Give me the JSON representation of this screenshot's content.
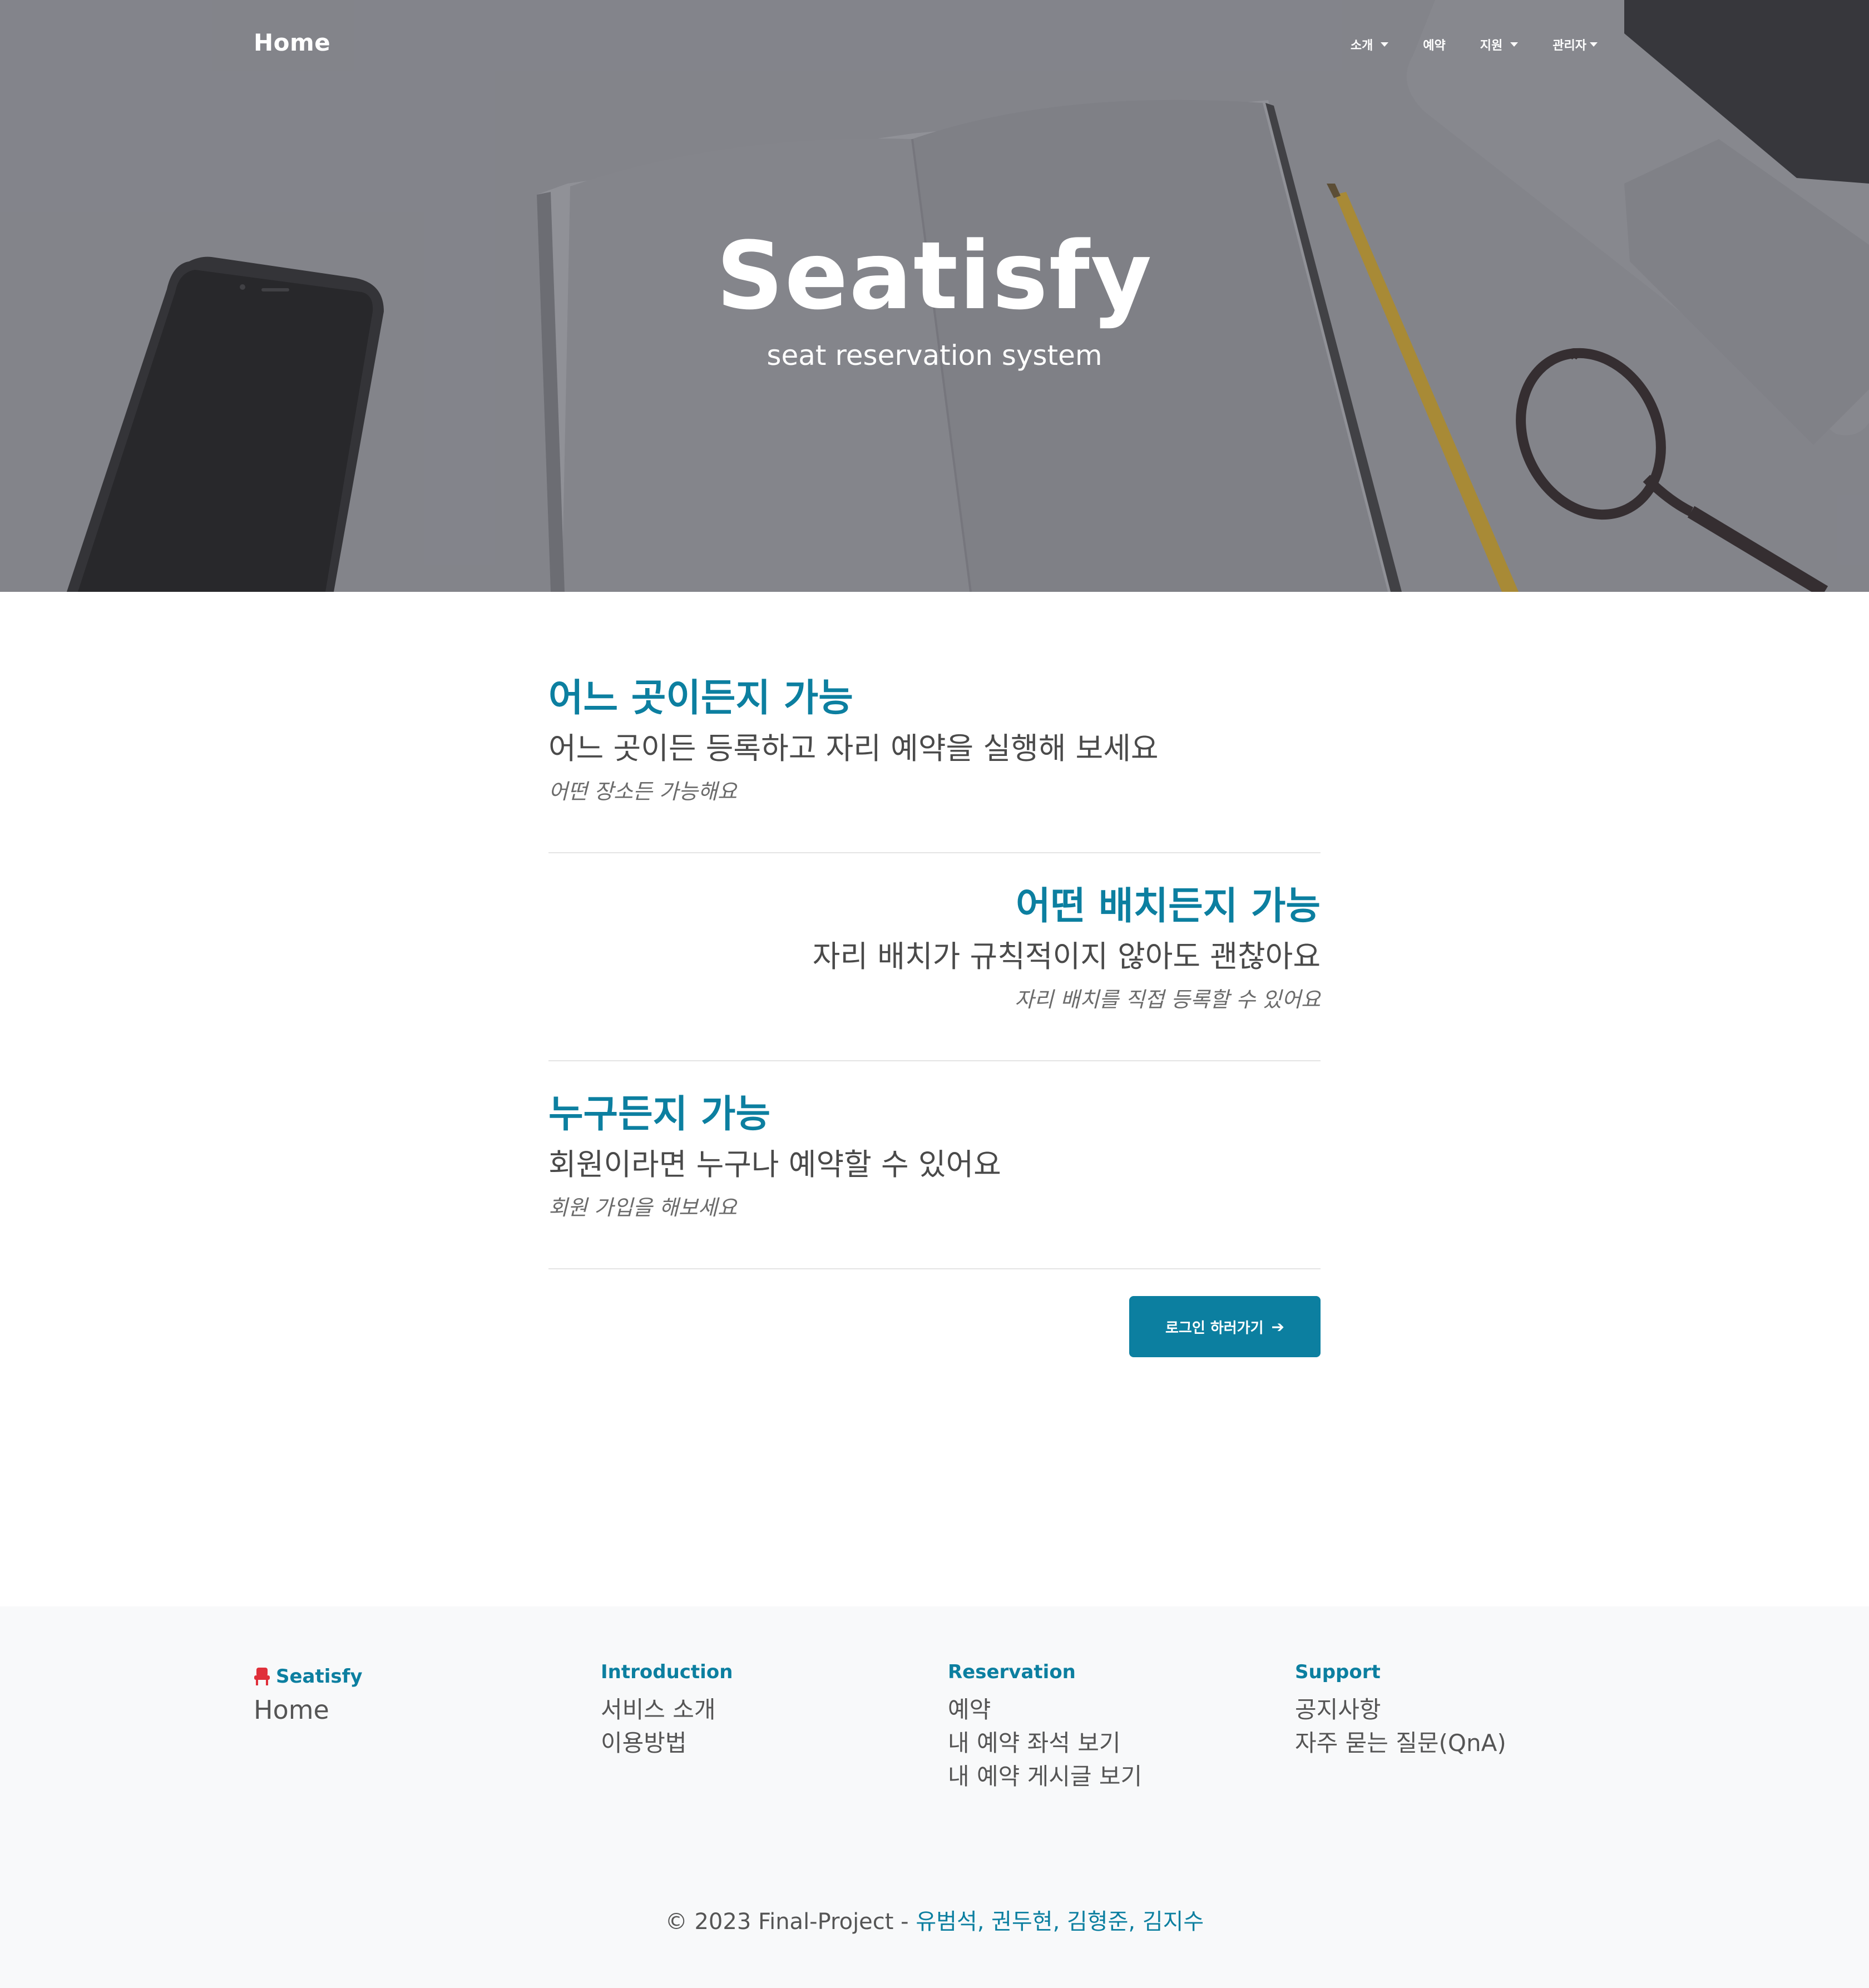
{
  "nav": {
    "brand": "Home",
    "items": [
      {
        "label": "소개",
        "dropdown": true
      },
      {
        "label": "예약",
        "dropdown": false
      },
      {
        "label": "지원",
        "dropdown": true
      },
      {
        "label": "관리자",
        "dropdown": true
      }
    ]
  },
  "hero": {
    "title": "Seatisfy",
    "subtitle": "seat reservation system"
  },
  "features": [
    {
      "title": "어느 곳이든지 가능",
      "description": "어느 곳이든 등록하고 자리 예약을 실행해 보세요",
      "note": "어떤 장소든 가능해요",
      "align": "left"
    },
    {
      "title": "어떤 배치든지 가능",
      "description": "자리 배치가 규칙적이지 않아도 괜찮아요",
      "note": "자리 배치를 직접 등록할 수 있어요",
      "align": "right"
    },
    {
      "title": "누구든지 가능",
      "description": "회원이라면 누구나 예약할 수 있어요",
      "note": "회원 가입을 해보세요",
      "align": "left"
    }
  ],
  "cta": {
    "label": "로그인 하러가기",
    "icon": "arrow-right-icon"
  },
  "footer": {
    "brand": "Seatisfy",
    "brand_icon": "seat-icon",
    "home": "Home",
    "columns": [
      {
        "heading": "Introduction",
        "links": [
          "서비스 소개",
          "이용방법"
        ]
      },
      {
        "heading": "Reservation",
        "links": [
          "예약",
          "내 예약 좌석 보기",
          "내 예약 게시글 보기"
        ]
      },
      {
        "heading": "Support",
        "links": [
          "공지사항",
          "자주 묻는 질문(QnA)"
        ]
      }
    ],
    "copyright_prefix": "© 2023 Final-Project - ",
    "authors": "유범석, 권두현, 김형준, 김지수"
  },
  "colors": {
    "accent": "#0c7fa0",
    "hero_overlay": "#7f8086",
    "footer_bg": "#f8f9fa",
    "seat_icon": "#e0303a"
  }
}
